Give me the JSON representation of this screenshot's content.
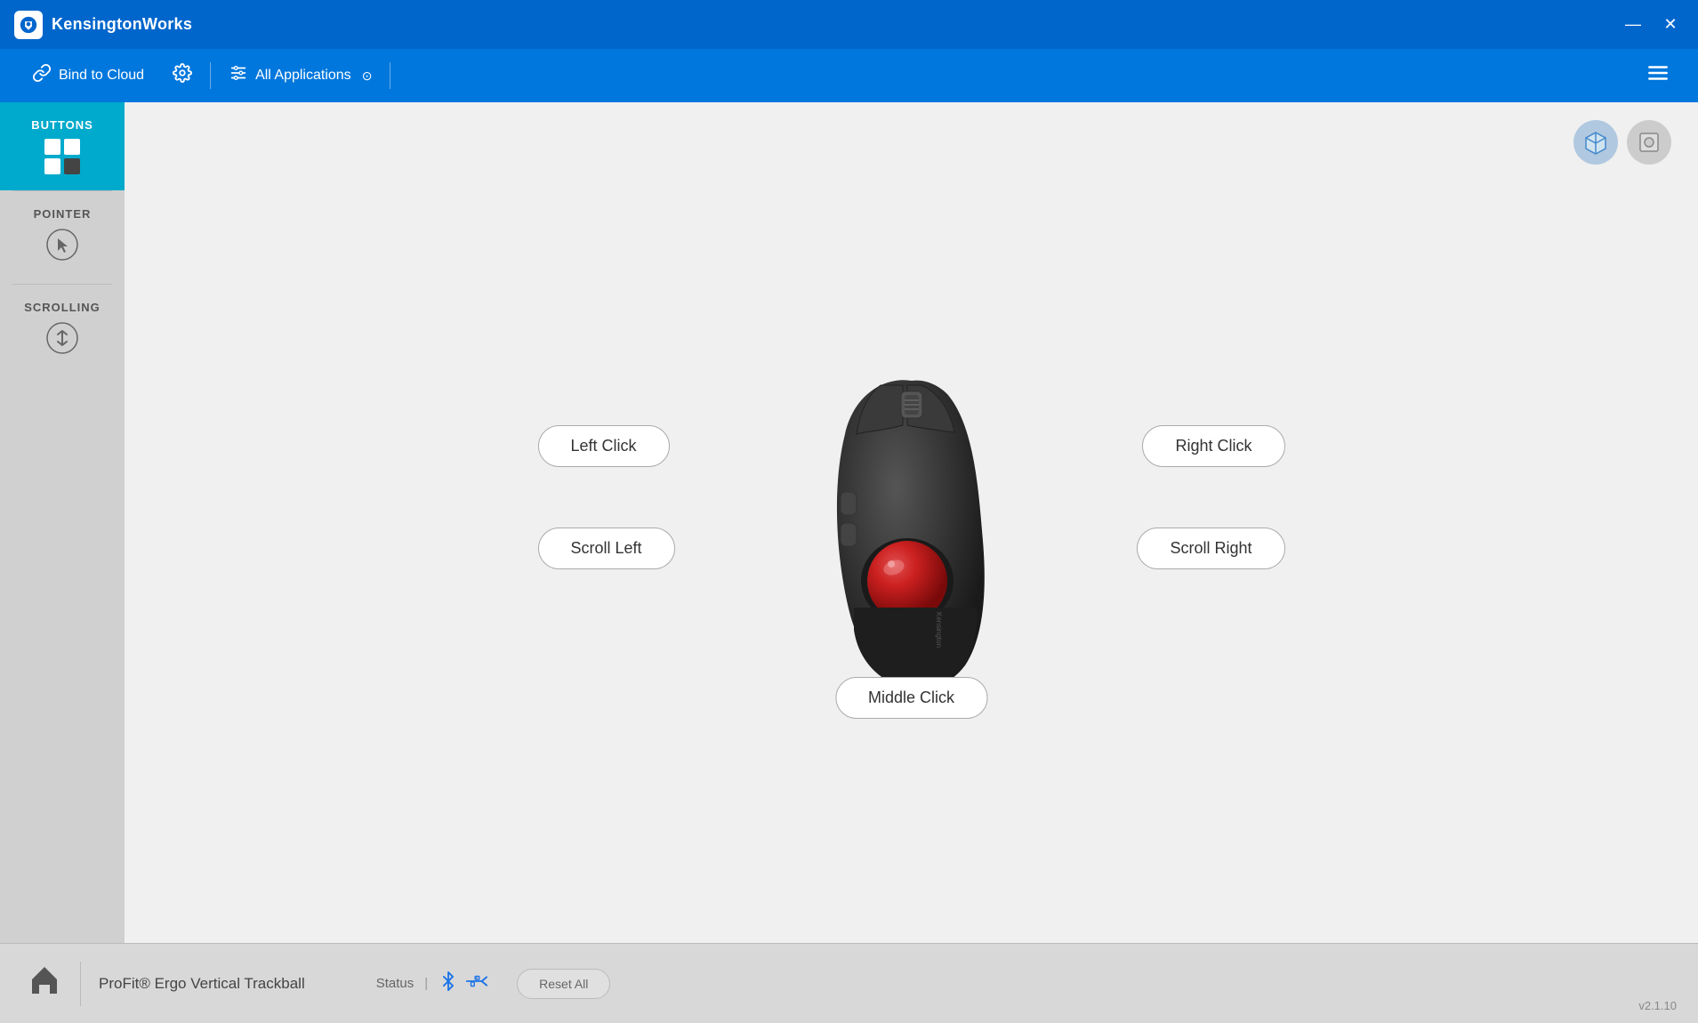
{
  "app": {
    "title": "KensingtonWorks",
    "version": "v2.1.10"
  },
  "titlebar": {
    "minimize_label": "—",
    "close_label": "✕"
  },
  "toolbar": {
    "bind_to_cloud": "Bind to Cloud",
    "all_applications": "All Applications",
    "chevron": "⊙"
  },
  "sidebar": {
    "items": [
      {
        "id": "buttons",
        "label": "BUTTONS",
        "active": true
      },
      {
        "id": "pointer",
        "label": "POINTER",
        "active": false
      },
      {
        "id": "scrolling",
        "label": "SCROLLING",
        "active": false
      }
    ]
  },
  "mouse_buttons": {
    "left_click": "Left Click",
    "right_click": "Right Click",
    "scroll_left": "Scroll Left",
    "scroll_right": "Scroll Right",
    "middle_click": "Middle Click"
  },
  "footer": {
    "device_name": "ProFit® Ergo Vertical Trackball",
    "status_label": "Status",
    "reset_all": "Reset All"
  },
  "icons": {
    "home": "⌂",
    "settings": "⚙",
    "tune": "≡",
    "menu": "☰",
    "link": "✦"
  }
}
